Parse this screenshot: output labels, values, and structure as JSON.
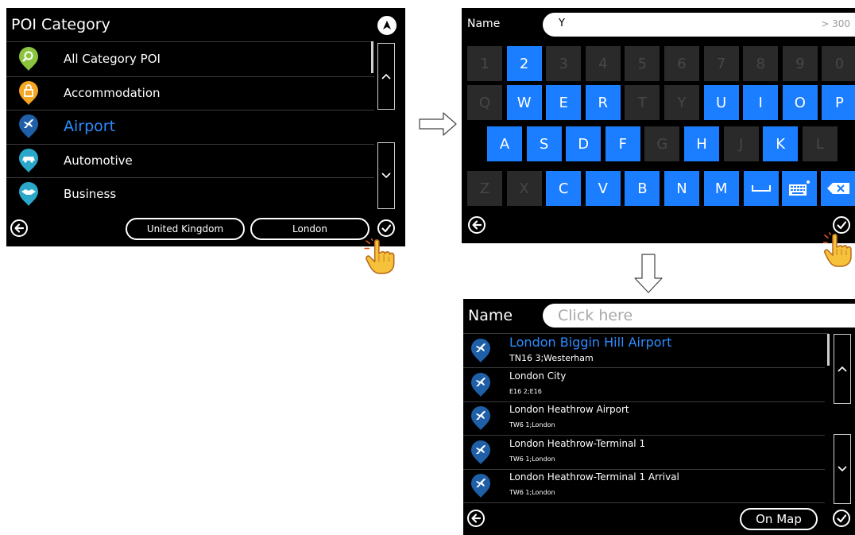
{
  "colors": {
    "accent": "#1b7dff",
    "selected_text": "#2b8cff",
    "panel_bg": "#000000"
  },
  "poi_panel": {
    "title": "POI Category",
    "categories": [
      {
        "label": "All Category POI",
        "icon": "search-pin-icon",
        "color": "#8bc53f",
        "selected": false
      },
      {
        "label": "Accommodation",
        "icon": "lock-pin-icon",
        "color": "#f5a623",
        "selected": false
      },
      {
        "label": "Airport",
        "icon": "airplane-pin-icon",
        "color": "#1e5fa8",
        "selected": true
      },
      {
        "label": "Automotive",
        "icon": "car-pin-icon",
        "color": "#2aa7c9",
        "selected": false
      },
      {
        "label": "Business",
        "icon": "handshake-pin-icon",
        "color": "#2aa7c9",
        "selected": false
      }
    ],
    "country_button": "United Kingdom",
    "city_button": "London"
  },
  "keyboard_panel": {
    "field_label": "Name",
    "field_value": "Y",
    "result_count": "> 300",
    "rows": [
      [
        {
          "k": "1",
          "on": false
        },
        {
          "k": "2",
          "on": true
        },
        {
          "k": "3",
          "on": false
        },
        {
          "k": "4",
          "on": false
        },
        {
          "k": "5",
          "on": false
        },
        {
          "k": "6",
          "on": false
        },
        {
          "k": "7",
          "on": false
        },
        {
          "k": "8",
          "on": false
        },
        {
          "k": "9",
          "on": false
        },
        {
          "k": "0",
          "on": false
        }
      ],
      [
        {
          "k": "Q",
          "on": false
        },
        {
          "k": "W",
          "on": true
        },
        {
          "k": "E",
          "on": true
        },
        {
          "k": "R",
          "on": true
        },
        {
          "k": "T",
          "on": false
        },
        {
          "k": "Y",
          "on": false
        },
        {
          "k": "U",
          "on": true
        },
        {
          "k": "I",
          "on": true
        },
        {
          "k": "O",
          "on": true
        },
        {
          "k": "P",
          "on": true
        }
      ],
      [
        {
          "k": "A",
          "on": true
        },
        {
          "k": "S",
          "on": true
        },
        {
          "k": "D",
          "on": true
        },
        {
          "k": "F",
          "on": true
        },
        {
          "k": "G",
          "on": false
        },
        {
          "k": "H",
          "on": true
        },
        {
          "k": "J",
          "on": false
        },
        {
          "k": "K",
          "on": true
        },
        {
          "k": "L",
          "on": false
        }
      ],
      [
        {
          "k": "Z",
          "on": false
        },
        {
          "k": "X",
          "on": false
        },
        {
          "k": "C",
          "on": true
        },
        {
          "k": "V",
          "on": true
        },
        {
          "k": "B",
          "on": true
        },
        {
          "k": "N",
          "on": true
        },
        {
          "k": "M",
          "on": true
        }
      ]
    ]
  },
  "results_panel": {
    "field_label": "Name",
    "placeholder": "Click here",
    "results": [
      {
        "title": "London Biggin Hill Airport",
        "sub": "TN16 3;Westerham",
        "selected": true
      },
      {
        "title": "London City",
        "sub": "E16 2;E16",
        "selected": false
      },
      {
        "title": "London Heathrow Airport",
        "sub": "TW6 1;London",
        "selected": false
      },
      {
        "title": "London Heathrow-Terminal 1",
        "sub": "TW6 1;London",
        "selected": false
      },
      {
        "title": "London Heathrow-Terminal 1 Arrival",
        "sub": "TW6 1;London",
        "selected": false
      }
    ],
    "on_map_button": "On Map"
  }
}
